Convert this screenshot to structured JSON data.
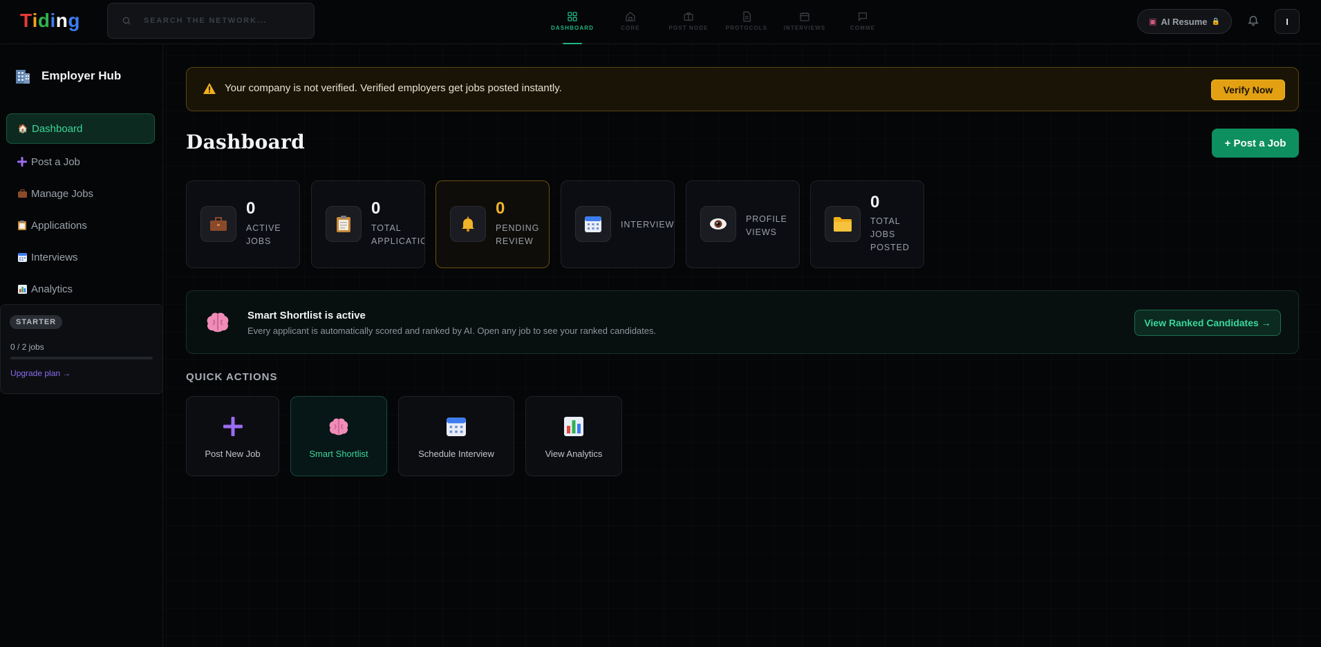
{
  "topbar": {
    "logo_letters": [
      "T",
      "i",
      "d",
      "i",
      "n",
      "g"
    ],
    "logo_colors": [
      "#e83a3a",
      "#f2a31b",
      "#2fb24f",
      "#3d7cf0",
      "#ffffff",
      "#3d7cf0"
    ],
    "search_placeholder": "SEARCH THE NETWORK...",
    "nav": [
      {
        "label": "DASHBOARD",
        "icon": "grid-icon",
        "active": true
      },
      {
        "label": "CORE",
        "icon": "home-icon",
        "active": false
      },
      {
        "label": "POST NODE",
        "icon": "briefcase-icon",
        "active": false
      },
      {
        "label": "PROTOCOLS",
        "icon": "document-icon",
        "active": false
      },
      {
        "label": "INTERVIEWS",
        "icon": "calendar-icon",
        "active": false
      },
      {
        "label": "COMME",
        "icon": "chat-icon",
        "active": false
      }
    ],
    "ai_resume_label": "AI Resume",
    "user_initial": "I"
  },
  "sidebar": {
    "title": "Employer Hub",
    "items": [
      {
        "label": "Dashboard",
        "icon": "house-icon",
        "active": true
      },
      {
        "label": "Post a Job",
        "icon": "plus-icon",
        "active": false
      },
      {
        "label": "Manage Jobs",
        "icon": "briefcase-icon",
        "active": false
      },
      {
        "label": "Applications",
        "icon": "clipboard-icon",
        "active": false
      },
      {
        "label": "Interviews",
        "icon": "calendar-icon",
        "active": false
      },
      {
        "label": "Analytics",
        "icon": "chart-icon",
        "active": false
      }
    ],
    "plan": {
      "badge": "STARTER",
      "usage": "0 / 2 jobs",
      "usage_fraction": 0,
      "upgrade": "Upgrade plan →"
    }
  },
  "alert": {
    "message": "Your company is not verified. Verified employers get jobs posted instantly.",
    "action": "Verify Now"
  },
  "page": {
    "title": "Dashboard",
    "post_job": "+ Post a Job"
  },
  "stats": [
    {
      "value": "0",
      "label_lines": [
        "ACTIVE",
        "JOBS"
      ],
      "icon": "briefcase-icon"
    },
    {
      "value": "0",
      "label_lines": [
        "TOTAL",
        "APPLICATIO"
      ],
      "icon": "clipboard-icon"
    },
    {
      "value": "0",
      "label_lines": [
        "PENDING",
        "REVIEW"
      ],
      "icon": "bell-icon",
      "highlight": true
    },
    {
      "value": "",
      "label_lines": [
        "INTERVIEWS"
      ],
      "icon": "calendar-icon"
    },
    {
      "value": "",
      "label_lines": [
        "PROFILE",
        "VIEWS"
      ],
      "icon": "eye-icon"
    },
    {
      "value": "0",
      "label_lines": [
        "TOTAL",
        "JOBS",
        "POSTED"
      ],
      "icon": "folder-icon"
    }
  ],
  "shortlist": {
    "title": "Smart Shortlist is active",
    "description": "Every applicant is automatically scored and ranked by AI. Open any job to see your ranked candidates.",
    "action": "View Ranked Candidates →"
  },
  "quick_actions": {
    "title": "QUICK ACTIONS",
    "items": [
      {
        "label": "Post New Job",
        "icon": "plus-icon"
      },
      {
        "label": "Smart Shortlist",
        "icon": "brain-icon",
        "active": true
      },
      {
        "label": "Schedule Interview",
        "icon": "calendar-icon"
      },
      {
        "label": "View Analytics",
        "icon": "chart-icon"
      }
    ]
  },
  "colors": {
    "accent": "#1fb582",
    "warning": "#e2a012",
    "primary_button": "#0e8f5f"
  }
}
